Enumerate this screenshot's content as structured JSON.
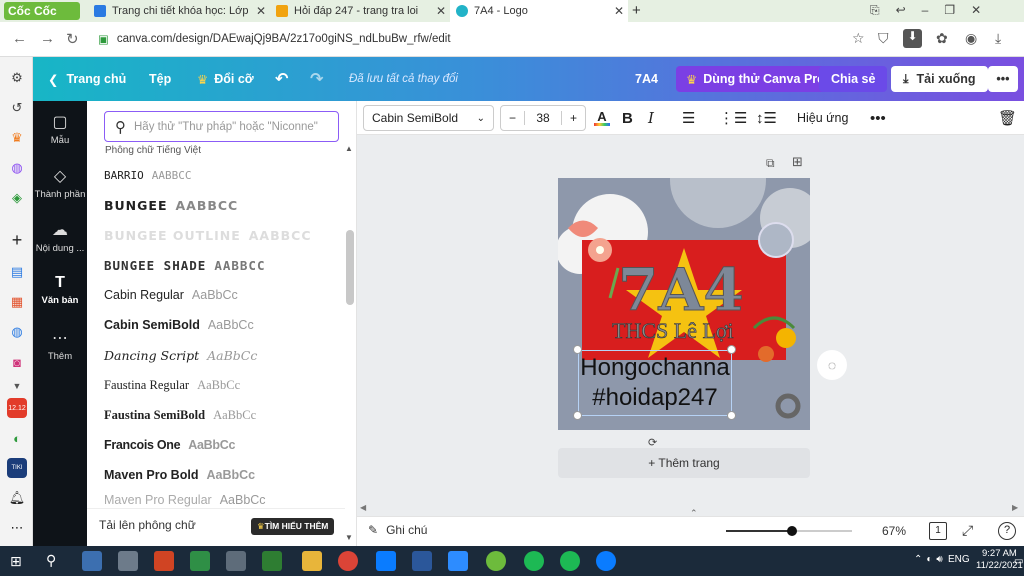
{
  "browser": {
    "brand": "Cốc Cốc",
    "tabs": [
      {
        "label": "Trang chi tiết khóa học: Lớp"
      },
      {
        "label": "Hỏi đáp 247 - trang tra loi"
      },
      {
        "label": "7A4 - Logo"
      }
    ],
    "url": "canva.com/design/DAEwajQj9BA/2z17o0giNS_ndLbuBw_rfw/edit"
  },
  "header": {
    "home": "Trang chủ",
    "file": "Tệp",
    "resize": "Đổi cỡ",
    "saved": "Đã lưu tất cả thay đổi",
    "design_name": "7A4",
    "try_pro": "Dùng thử Canva Pro",
    "share": "Chia sẻ",
    "download": "Tải xuống"
  },
  "sidenav": [
    {
      "label": "Mẫu",
      "icon": "template-icon"
    },
    {
      "label": "Thành phần",
      "icon": "elements-icon"
    },
    {
      "label": "Nội dung ...",
      "icon": "upload-icon"
    },
    {
      "label": "Văn bản",
      "icon": "text-icon"
    },
    {
      "label": "Thêm",
      "icon": "more-icon"
    }
  ],
  "fontpanel": {
    "search_placeholder": "Hãy thử \"Thư pháp\" hoặc \"Niconne\"",
    "section": "Phông chữ Tiếng Việt",
    "fonts": [
      {
        "name": "BARRIO",
        "sample": "AABBCC"
      },
      {
        "name": "BUNGEE",
        "sample": "AABBCC"
      },
      {
        "name": "BUNGEE OUTLINE",
        "sample": "AABBCC"
      },
      {
        "name": "BUNGEE SHADE",
        "sample": "AABBCC"
      },
      {
        "name": "Cabin Regular",
        "sample": "AaBbCc"
      },
      {
        "name": "Cabin SemiBold",
        "sample": "AaBbCc"
      },
      {
        "name": "Dancing Script",
        "sample": "AaBbCc"
      },
      {
        "name": "Faustina Regular",
        "sample": "AaBbCc"
      },
      {
        "name": "Faustina SemiBold",
        "sample": "AaBbCc"
      },
      {
        "name": "Francois One",
        "sample": "AaBbCc"
      },
      {
        "name": "Maven Pro Bold",
        "sample": "AaBbCc"
      },
      {
        "name": "Maven Pro Regular",
        "sample": "AaBbCc"
      }
    ],
    "upload": "Tải lên phông chữ",
    "learn_more": "TÌM HIỂU THÊM"
  },
  "toolbar": {
    "font": "Cabin SemiBold",
    "size": "38",
    "effects": "Hiệu ứng"
  },
  "design": {
    "title": "7A4",
    "school": "THCS Lê Lợi",
    "line1": "Hongochanna",
    "line2": "#hoidap247",
    "add_page": "+ Thêm trang",
    "colors": {
      "bg": "#8e98ab",
      "flag": "#d81e1e",
      "star": "#f5c211"
    }
  },
  "footer": {
    "notes": "Ghi chú",
    "zoom": "67%",
    "zoom_level": 0.52,
    "page": "1"
  },
  "taskbar": {
    "lang": "ENG",
    "time": "9:27 AM",
    "date": "11/22/2021"
  }
}
